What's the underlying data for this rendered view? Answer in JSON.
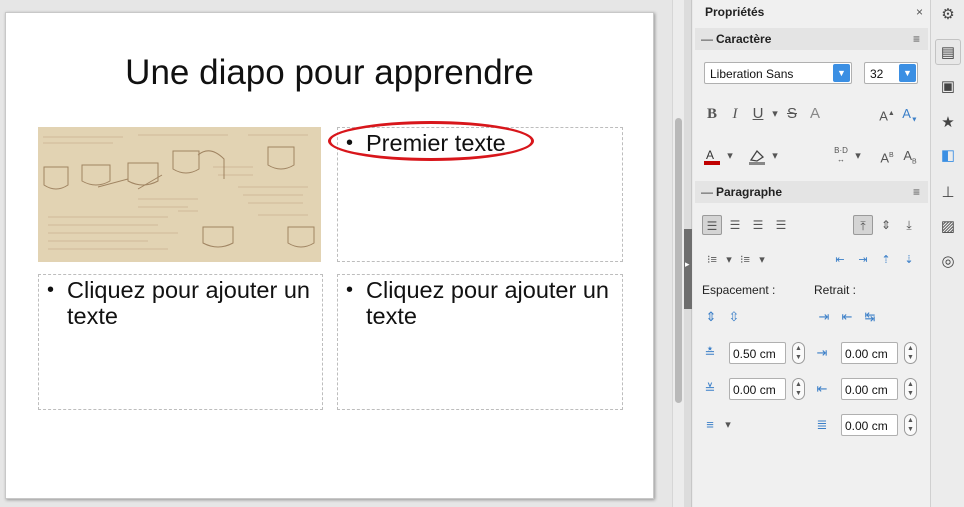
{
  "slide": {
    "title": "Une diapo pour apprendre",
    "top_right_bullet": "Premier texte",
    "bottom_left_bullet": "Cliquez pour ajouter un texte",
    "bottom_right_bullet": "Cliquez pour ajouter un texte",
    "bullet_char": "•"
  },
  "panel": {
    "title": "Propriétés",
    "close": "×",
    "character": {
      "title": "Caractère",
      "font_name": "Liberation Sans",
      "font_size": "32",
      "bold": "B",
      "italic": "I",
      "underline": "U",
      "strike": "S",
      "shadow": "A",
      "grow": "A",
      "shrink": "A",
      "font_color_icon": "font-color-icon",
      "highlight_icon": "highlight-icon",
      "spacing_icon": "character-spacing-icon",
      "superscript": "A",
      "subscript": "A"
    },
    "paragraph": {
      "title": "Paragraphe",
      "spacing_label": "Espacement :",
      "indent_label": "Retrait :",
      "above_spacing": "0.50 cm",
      "below_spacing": "0.00 cm",
      "before_indent": "0.00 cm",
      "after_indent": "0.00 cm",
      "first_line_indent": "0.00 cm"
    }
  },
  "colors": {
    "accent_blue": "#3b8fe3",
    "highlight_red": "#d8161b",
    "font_color_red": "#c00000"
  }
}
